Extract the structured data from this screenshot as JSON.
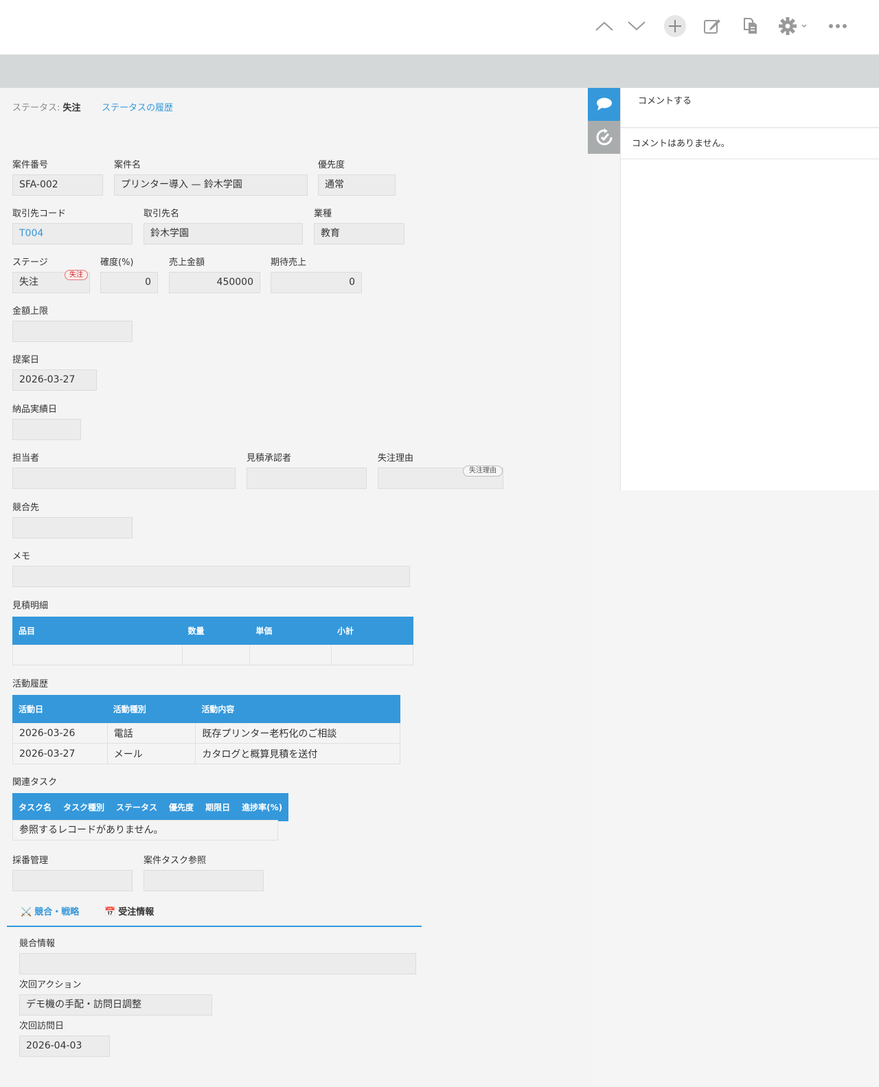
{
  "toolbar": {
    "icons": [
      "chevron-up-icon",
      "chevron-down-icon",
      "add-icon",
      "edit-icon",
      "duplicate-icon",
      "gear-icon",
      "more-icon"
    ]
  },
  "status": {
    "label": "ステータス:",
    "value": "失注",
    "history_link": "ステータスの履歴"
  },
  "fields": {
    "case_no": {
      "label": "案件番号",
      "value": "SFA-002"
    },
    "case_name": {
      "label": "案件名",
      "value": "プリンター導入 — 鈴木学園"
    },
    "priority": {
      "label": "優先度",
      "value": "通常"
    },
    "client_code": {
      "label": "取引先コード",
      "value": "T004"
    },
    "client_name": {
      "label": "取引先名",
      "value": "鈴木学園"
    },
    "industry": {
      "label": "業種",
      "value": "教育"
    },
    "stage": {
      "label": "ステージ",
      "value": "失注",
      "badge": "失注"
    },
    "probability": {
      "label": "確度(%)",
      "value": "0"
    },
    "sales_amount": {
      "label": "売上金額",
      "value": "450000"
    },
    "expected_sales": {
      "label": "期待売上",
      "value": "0"
    },
    "amount_limit": {
      "label": "金額上限",
      "value": ""
    },
    "proposal_date": {
      "label": "提案日",
      "value": "2026-03-27"
    },
    "delivery_date": {
      "label": "納品実績日",
      "value": ""
    },
    "owner": {
      "label": "担当者",
      "value": ""
    },
    "estimate_approver": {
      "label": "見積承認者",
      "value": ""
    },
    "lost_reason": {
      "label": "失注理由",
      "value": "",
      "badge": "失注理由"
    },
    "competitor": {
      "label": "競合先",
      "value": ""
    },
    "memo": {
      "label": "メモ",
      "value": ""
    },
    "numbering": {
      "label": "採番管理",
      "value": ""
    },
    "case_task_ref": {
      "label": "案件タスク参照",
      "value": ""
    }
  },
  "estimate_table": {
    "label": "見積明細",
    "headers": [
      "品目",
      "数量",
      "単価",
      "小計"
    ]
  },
  "activity_table": {
    "label": "活動履歴",
    "headers": [
      "活動日",
      "活動種別",
      "活動内容"
    ],
    "rows": [
      [
        "2026-03-26",
        "電話",
        "既存プリンター老朽化のご相談"
      ],
      [
        "2026-03-27",
        "メール",
        "カタログと概算見積を送付"
      ]
    ]
  },
  "task_table": {
    "label": "関連タスク",
    "headers": [
      "タスク名",
      "タスク種別",
      "ステータス",
      "優先度",
      "期限日",
      "進捗率(%)"
    ],
    "empty_message": "参照するレコードがありません。"
  },
  "tabs": [
    {
      "icon": "⚔️",
      "label": "競合・戦略",
      "active": true
    },
    {
      "icon": "📅",
      "label": "受注情報",
      "active": false
    }
  ],
  "tab_fields": {
    "competition_info": {
      "label": "競合情報",
      "value": ""
    },
    "next_action": {
      "label": "次回アクション",
      "value": "デモ機の手配・訪問日調整"
    },
    "next_visit": {
      "label": "次回訪問日",
      "value": "2026-04-03"
    }
  },
  "sidebar": {
    "comment_placeholder": "コメントする",
    "no_comments": "コメントはありません。"
  },
  "colors": {
    "accent": "#3498db",
    "header_band": "#d5d8d9",
    "badge_red": "#c62828"
  }
}
